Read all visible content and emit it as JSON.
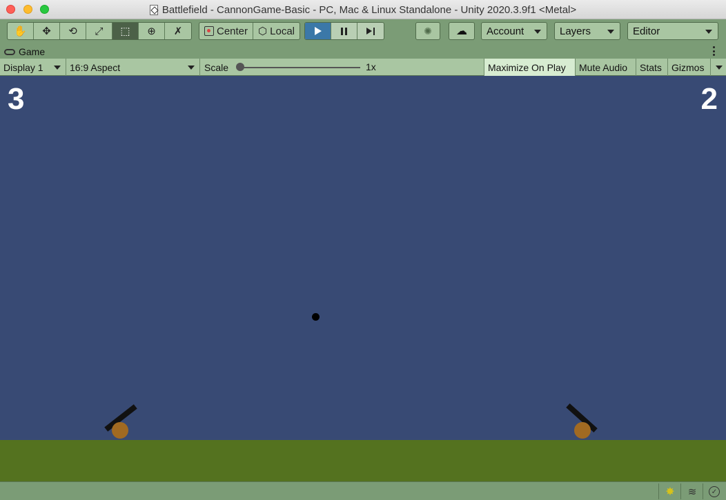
{
  "window": {
    "title": "Battlefield - CannonGame-Basic - PC, Mac & Linux Standalone - Unity 2020.3.9f1 <Metal>"
  },
  "toolbar": {
    "tools": [
      {
        "name": "hand-tool",
        "icon": "hand-icon",
        "glyph": "✋",
        "active": false
      },
      {
        "name": "move-tool",
        "icon": "move-icon",
        "glyph": "✥",
        "active": false
      },
      {
        "name": "rotate-tool",
        "icon": "rotate-icon",
        "glyph": "⟲",
        "active": false
      },
      {
        "name": "scale-tool",
        "icon": "scale-icon",
        "glyph": "⤢",
        "active": false
      },
      {
        "name": "rect-tool",
        "icon": "rect-icon",
        "glyph": "⬚",
        "active": true
      },
      {
        "name": "transform-tool",
        "icon": "transform-icon",
        "glyph": "⊕",
        "active": false
      },
      {
        "name": "custom-tool",
        "icon": "wrench-icon",
        "glyph": "✗",
        "active": false
      }
    ],
    "pivot_label": "Center",
    "space_label": "Local",
    "account_label": "Account",
    "layers_label": "Layers",
    "layout_label": "Editor",
    "playing": true
  },
  "tab": {
    "label": "Game"
  },
  "game_view": {
    "display_label": "Display 1",
    "aspect_label": "16:9 Aspect",
    "scale_label": "Scale",
    "scale_value": "1x",
    "scale_level": 0,
    "maximize_label": "Maximize On Play",
    "maximize_on": true,
    "mute_label": "Mute Audio",
    "stats_label": "Stats",
    "gizmos_label": "Gizmos"
  },
  "game": {
    "score_left": "3",
    "score_right": "2",
    "colors": {
      "sky": "#384a74",
      "ground": "#54721f",
      "wheel": "#a16a22",
      "barrel": "#111111",
      "cannonball": "#000000"
    },
    "left_cannon_angle_deg": -38,
    "right_cannon_angle_deg": 42
  },
  "colors": {
    "editor_accent": "#7b9c76",
    "play_active": "#3b78a8"
  }
}
